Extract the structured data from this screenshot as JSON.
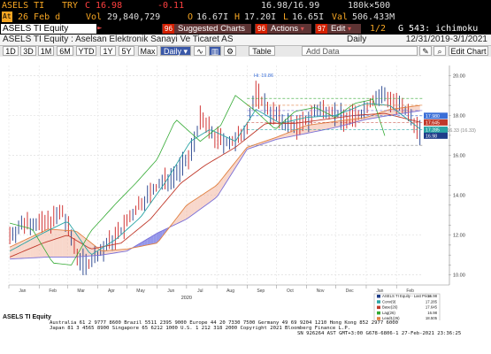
{
  "header": {
    "ticker": "ASELS TI",
    "currency": "TRY",
    "change_flag": "C",
    "last_price": "16.98",
    "change": "-0.11",
    "bid_ask": "16.98/16.99",
    "bid_ask_size": "180k×500",
    "date_flag": "At",
    "date": "26 Feb d",
    "vol_label": "Vol",
    "volume": "29,840,729",
    "open_label": "O",
    "open": "16.67I",
    "high_label": "H",
    "high": "17.20I",
    "low_label": "L",
    "low": "16.65I",
    "val_label": "Val",
    "value": "506.433M"
  },
  "toolbar": {
    "security_label": "ASELS TI Equity",
    "buttons": [
      {
        "num": "96",
        "label": "Suggested Charts"
      },
      {
        "num": "96",
        "label": "Actions"
      },
      {
        "num": "97",
        "label": "Edit"
      }
    ],
    "page": "1/2",
    "function": "G 543: ichimoku"
  },
  "panel": {
    "title": "ASELS TI Equity : Aselsan Elektronik Sanayi Ve Ticaret AS",
    "period": "Daily",
    "range": "12/31/2019-3/1/2021",
    "range_buttons": [
      "1D",
      "3D",
      "1M",
      "6M",
      "YTD",
      "1Y",
      "5Y",
      "Max"
    ],
    "frequency": "Daily",
    "table_label": "Table",
    "add_data_placeholder": "Add Data",
    "edit_chart": "Edit Chart"
  },
  "chart_data": {
    "type": "line",
    "title": "ASELS TI Equity",
    "ylim": [
      9.5,
      20.5
    ],
    "yticks": [
      "20.00",
      "18.00",
      "16.00",
      "14.00",
      "12.00",
      "10.00"
    ],
    "month_labels": [
      "Jan",
      "Feb",
      "Mar",
      "Apr",
      "May",
      "Jun",
      "Jul",
      "Aug",
      "Sep",
      "Oct",
      "Nov",
      "Dec",
      "Jan",
      "Feb"
    ],
    "year_labels": [
      "2020",
      "2021"
    ],
    "high_annotation": "Hi: 19.86",
    "low_annotation": "Lo: 16.33 (16.33)",
    "right_labels": [
      {
        "text": "17.980",
        "color": "#3a6fd8"
      },
      {
        "text": "17.645",
        "color": "#c0392b"
      },
      {
        "text": "17.285",
        "color": "#2aa5a5"
      },
      {
        "text": "16.98",
        "color": "#1f3d8a"
      }
    ],
    "series": [
      {
        "name": "ASELS TI Equity - Last Price",
        "value": "16.98",
        "color": "#1f3d8a",
        "x": [
          "2020-01-02",
          "2020-01-20",
          "2020-02-05",
          "2020-02-25",
          "2020-03-12",
          "2020-03-20",
          "2020-04-05",
          "2020-04-25",
          "2020-05-15",
          "2020-06-05",
          "2020-06-20",
          "2020-07-03",
          "2020-07-15",
          "2020-08-01",
          "2020-08-20",
          "2020-09-01",
          "2020-09-10",
          "2020-09-25",
          "2020-10-10",
          "2020-10-25",
          "2020-11-10",
          "2020-11-25",
          "2020-12-10",
          "2020-12-25",
          "2021-01-08",
          "2021-01-20",
          "2021-02-05",
          "2021-02-18",
          "2021-02-26"
        ],
        "y": [
          12.0,
          12.7,
          12.5,
          13.1,
          10.9,
          10.5,
          11.2,
          12.2,
          13.6,
          14.6,
          15.1,
          15.8,
          17.8,
          16.8,
          16.6,
          17.5,
          19.1,
          18.2,
          17.6,
          17.4,
          18.2,
          18.3,
          17.8,
          18.0,
          18.8,
          19.0,
          18.4,
          17.8,
          16.98
        ]
      },
      {
        "name": "Conv(9)",
        "value": "17.285",
        "color": "#2aa5a5",
        "x": [
          "2020-01-02",
          "2020-02-05",
          "2020-03-01",
          "2020-03-25",
          "2020-04-20",
          "2020-05-15",
          "2020-06-10",
          "2020-07-05",
          "2020-07-25",
          "2020-08-20",
          "2020-09-10",
          "2020-10-05",
          "2020-11-01",
          "2020-12-01",
          "2021-01-01",
          "2021-01-25",
          "2021-02-26"
        ],
        "y": [
          11.2,
          12.1,
          12.7,
          11.0,
          11.8,
          12.9,
          14.7,
          16.7,
          17.3,
          16.7,
          18.3,
          17.6,
          17.9,
          18.0,
          18.6,
          18.5,
          17.285
        ]
      },
      {
        "name": "Base(26)",
        "value": "17.645",
        "color": "#c0392b",
        "x": [
          "2020-01-02",
          "2020-02-05",
          "2020-03-01",
          "2020-03-25",
          "2020-04-25",
          "2020-05-25",
          "2020-06-25",
          "2020-07-20",
          "2020-08-20",
          "2020-09-20",
          "2020-10-20",
          "2020-11-20",
          "2020-12-20",
          "2021-01-20",
          "2021-02-26"
        ],
        "y": [
          10.9,
          11.6,
          12.0,
          11.3,
          11.6,
          12.8,
          14.6,
          15.5,
          16.4,
          17.6,
          17.6,
          17.8,
          18.0,
          18.1,
          17.645
        ]
      },
      {
        "name": "Lag(26)",
        "value": "16.98",
        "color": "#33aa33",
        "x": [
          "2020-01-02",
          "2020-01-25",
          "2020-02-15",
          "2020-03-05",
          "2020-03-25",
          "2020-04-20",
          "2020-05-10",
          "2020-06-01",
          "2020-06-20",
          "2020-07-15",
          "2020-08-05",
          "2020-08-20",
          "2020-09-10",
          "2020-09-30",
          "2020-10-20",
          "2020-11-10",
          "2020-11-30",
          "2020-12-20",
          "2021-01-08",
          "2021-01-20"
        ],
        "y": [
          12.6,
          12.3,
          10.6,
          10.5,
          12.2,
          13.6,
          14.6,
          15.8,
          17.8,
          16.7,
          17.5,
          19.0,
          18.2,
          17.3,
          18.2,
          18.4,
          17.9,
          18.6,
          18.8,
          16.98
        ]
      },
      {
        "name": "Lead1(26)",
        "value": "18.505",
        "color": "#e08040",
        "x": [
          "2020-01-02",
          "2020-02-10",
          "2020-03-10",
          "2020-04-05",
          "2020-05-01",
          "2020-06-01",
          "2020-07-01",
          "2020-08-01",
          "2020-09-01",
          "2020-10-01",
          "2020-11-01",
          "2020-12-01",
          "2021-01-01",
          "2021-01-25",
          "2021-02-26"
        ],
        "y": [
          11.4,
          12.3,
          12.2,
          11.2,
          11.3,
          11.6,
          13.5,
          14.5,
          16.4,
          16.9,
          17.5,
          17.7,
          17.9,
          18.3,
          18.505
        ]
      },
      {
        "name": "Lead2(26)",
        "value": "18.24",
        "color": "#7a70d8",
        "x": [
          "2020-01-02",
          "2020-02-10",
          "2020-03-10",
          "2020-04-05",
          "2020-05-01",
          "2020-06-01",
          "2020-07-01",
          "2020-08-01",
          "2020-09-01",
          "2020-10-01",
          "2020-11-01",
          "2020-12-01",
          "2021-01-01",
          "2021-01-25",
          "2021-02-26"
        ],
        "y": [
          10.8,
          10.9,
          10.9,
          11.0,
          11.2,
          12.1,
          12.8,
          13.9,
          16.3,
          16.8,
          17.1,
          17.4,
          17.8,
          18.0,
          18.24
        ]
      }
    ],
    "legend_position": "bottom-right"
  },
  "footer": {
    "line1": "Australia 61 2 9777 8600 Brazil 5511 2395 9000 Europe 44 20 7330 7500 Germany 49 69 9204 1210 Hong Kong 852 2977 6000",
    "line2": "Japan 81 3 4565 8900       Singapore 65 6212 1000       U.S. 1 212 318 2000           Copyright 2021 Bloomberg Finance L.P.",
    "line3": "SN 926264 AST  GMT+3:00 G678-6806-1 27-Feb-2021 23:36:25"
  },
  "colors": {
    "amber": "#f6a623",
    "red": "#ff3333",
    "white": "#ffffff"
  }
}
